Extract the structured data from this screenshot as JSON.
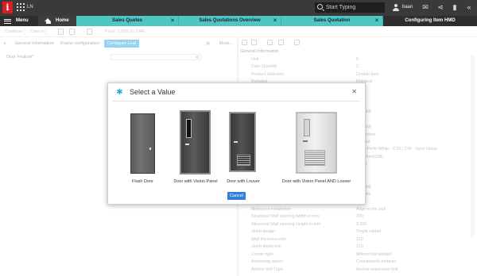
{
  "topbar": {
    "app_code": "LN",
    "search_placeholder": "Start Typing",
    "username": "baan"
  },
  "tabs": {
    "menu": "Menu",
    "home": "Home",
    "sales_quotes": "Sales Quotes",
    "sales_quotations_overview": "Sales Quotations Overview",
    "sales_quotation": "Sales Quotation",
    "configuring_item": "Configuring Item HMD"
  },
  "toolbar": {
    "continue": "Continue",
    "cancel": "Cancel",
    "price": "Price: 2,080.00 SAR"
  },
  "inner_tabs": {
    "general": "General Information",
    "frame": "Frame configuration",
    "leaf": "Configure Leaf",
    "more": "More..."
  },
  "left_panel": {
    "field_label": "Door Feature*"
  },
  "right_panel": {
    "section_title": "General Information",
    "rows": [
      {
        "k": "Unit",
        "v": "0"
      },
      {
        "k": "Door Quantity",
        "v": "2"
      },
      {
        "k": "Product Selection",
        "v": "Double door"
      },
      {
        "k": "Rebated",
        "v": "Rebated"
      },
      {
        "k": "",
        "v": ""
      },
      {
        "k": "",
        "v": ""
      },
      {
        "k": "",
        "v": "wall"
      },
      {
        "k": "",
        "v": "elected]"
      },
      {
        "k": "",
        "v": ""
      },
      {
        "k": "",
        "v": "elected]"
      },
      {
        "k": "",
        "v": "and Active"
      },
      {
        "k": "",
        "v": "er Coat"
      },
      {
        "k": "",
        "v": "012 - Perfo White - CTX / CW - Semi Gloss"
      },
      {
        "k": "",
        "v": "e Texture(CW)"
      },
      {
        "k": "",
        "v": "Gloss"
      },
      {
        "k": "",
        "v": ""
      },
      {
        "k": "",
        "v": ""
      },
      {
        "k": "",
        "v": "elected]"
      },
      {
        "k": "",
        "v": "ensions"
      },
      {
        "k": "",
        "v": ""
      },
      {
        "k": "Method of installation",
        "v": "Align to the wall"
      },
      {
        "k": "Structural Wall opening Width in mm",
        "v": "200"
      },
      {
        "k": "Structural Wall opening Height in mm",
        "v": "2,200"
      },
      {
        "k": "Jamb design",
        "v": "Single rabbet"
      },
      {
        "k": "Wall thickness mm",
        "v": "120"
      },
      {
        "k": "Jamb depth mm",
        "v": "120"
      },
      {
        "k": "Corner type",
        "v": "Mitered full welded"
      },
      {
        "k": "Anchoring option",
        "v": "Countersunk emboss"
      },
      {
        "k": "Anchor bolt Type",
        "v": "Anchor expansion bolt"
      }
    ]
  },
  "modal": {
    "title": "Select a Value",
    "options": [
      {
        "label": "Flush Door"
      },
      {
        "label": "Door with Vision Panel"
      },
      {
        "label": "Door with Louver"
      },
      {
        "label": "Door with Vision Panel AND Louver"
      }
    ],
    "cancel": "Cancel"
  },
  "colors": {
    "teal_tab": "#4ec7c4",
    "accent_blue": "#2fa4e7",
    "logo_red": "#d81f26",
    "topbar": "#3a3a3a"
  }
}
